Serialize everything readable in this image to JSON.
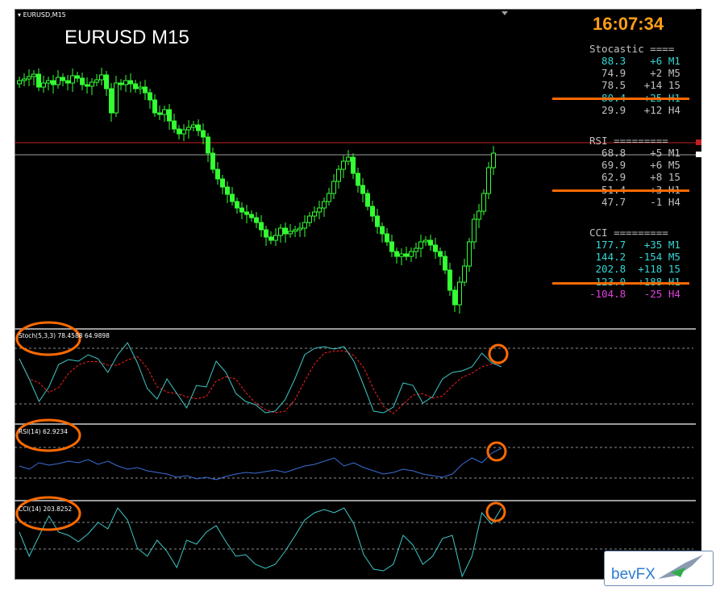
{
  "chart": {
    "window_title": "EURUSD,M15",
    "symbol_label": "EURUSD  M15",
    "clock": "16:07:34"
  },
  "stochastic": {
    "header": "Stocastic ====",
    "rows": [
      {
        "value": "88.3",
        "change": "+6",
        "tf": "M1",
        "color": "#36d6d6"
      },
      {
        "value": "74.9",
        "change": "+2",
        "tf": "M5",
        "color": "#c0c0c0"
      },
      {
        "value": "78.5",
        "change": "+14",
        "tf": "15",
        "color": "#c0c0c0"
      },
      {
        "value": "80.4",
        "change": "+25",
        "tf": "H1",
        "color": "#36d6d6"
      },
      {
        "value": "29.9",
        "change": "+12",
        "tf": "H4",
        "color": "#c0c0c0"
      }
    ]
  },
  "rsi": {
    "header": "RSI =========",
    "rows": [
      {
        "value": "68.8",
        "change": "+5",
        "tf": "M1",
        "color": "#c0c0c0"
      },
      {
        "value": "69.9",
        "change": "+6",
        "tf": "M5",
        "color": "#c0c0c0"
      },
      {
        "value": "62.9",
        "change": "+8",
        "tf": "15",
        "color": "#c0c0c0"
      },
      {
        "value": "51.4",
        "change": "+3",
        "tf": "H1",
        "color": "#c0c0c0"
      },
      {
        "value": "47.7",
        "change": "-1",
        "tf": "H4",
        "color": "#c0c0c0"
      }
    ]
  },
  "cci": {
    "header": "CCI =========",
    "rows": [
      {
        "value": "177.7",
        "change": "+35",
        "tf": "M1",
        "color": "#36d6d6"
      },
      {
        "value": "144.2",
        "change": "-154",
        "tf": "M5",
        "color": "#36d6d6"
      },
      {
        "value": "202.8",
        "change": "+118",
        "tf": "15",
        "color": "#36d6d6"
      },
      {
        "value": "123.0",
        "change": "+188",
        "tf": "H1",
        "color": "#36d6d6"
      },
      {
        "value": "-104.8",
        "change": "-25",
        "tf": "H4",
        "color": "#e040e0"
      }
    ]
  },
  "subwindows": {
    "stoch_label": "Stoch(5,3,3) 78.4588 64.9898",
    "rsi_label": "RSI(14) 62.9234",
    "cci_label": "CCI(14) 203.8252"
  },
  "logo": {
    "text": "bevFX"
  },
  "colors": {
    "bull": "#33ff33",
    "bear": "#33ff33",
    "accent": "#ff6a00",
    "clock": "#ff9d1a",
    "stoch_main": "#3fc7c7",
    "stoch_signal": "#ff2020",
    "rsi": "#3a6fd8",
    "cci": "#3fc7c7"
  }
}
